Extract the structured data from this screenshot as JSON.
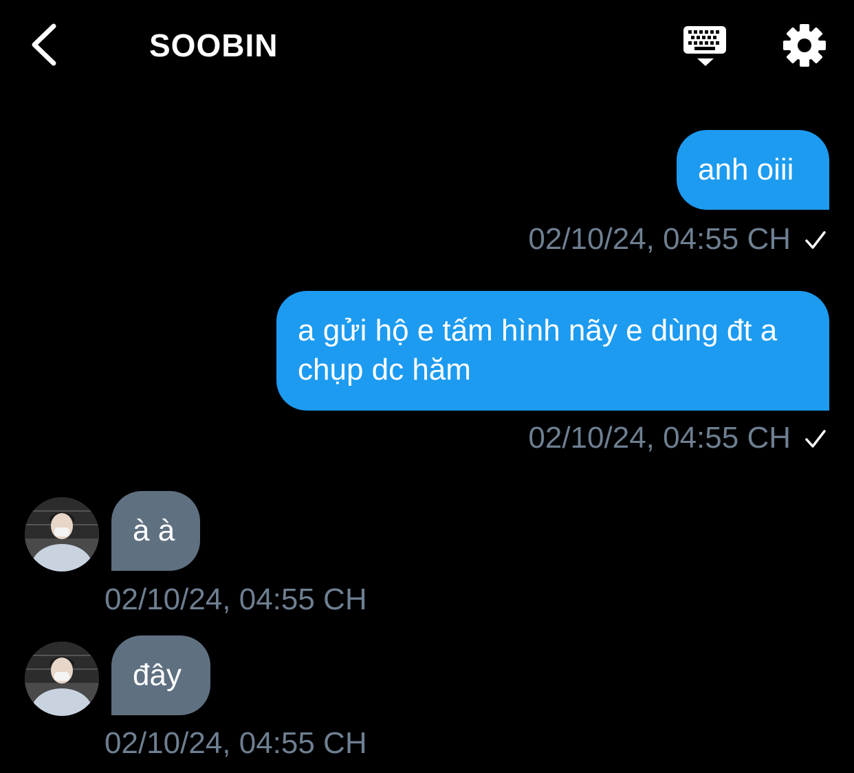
{
  "header": {
    "title": "SOOBIN",
    "back_icon": "chevron-left-icon",
    "keyboard_icon": "keyboard-icon",
    "settings_icon": "gear-icon"
  },
  "colors": {
    "background": "#000000",
    "outgoing_bubble": "#1d9bf0",
    "incoming_bubble": "#5f7081",
    "timestamp": "#6e7f91",
    "text": "#ffffff"
  },
  "messages": [
    {
      "direction": "outgoing",
      "text": "anh oiii",
      "time": "02/10/24, 04:55 CH",
      "status_icon": "check-icon"
    },
    {
      "direction": "outgoing",
      "text": "a gửi hộ e tấm hình nãy e dùng đt a chụp dc hăm",
      "time": "02/10/24, 04:55 CH",
      "status_icon": "check-icon"
    },
    {
      "direction": "incoming",
      "text": "à à",
      "time": "02/10/24, 04:55 CH",
      "avatar_icon": "avatar"
    },
    {
      "direction": "incoming",
      "text": "đây",
      "time": "02/10/24, 04:55 CH",
      "avatar_icon": "avatar"
    }
  ]
}
